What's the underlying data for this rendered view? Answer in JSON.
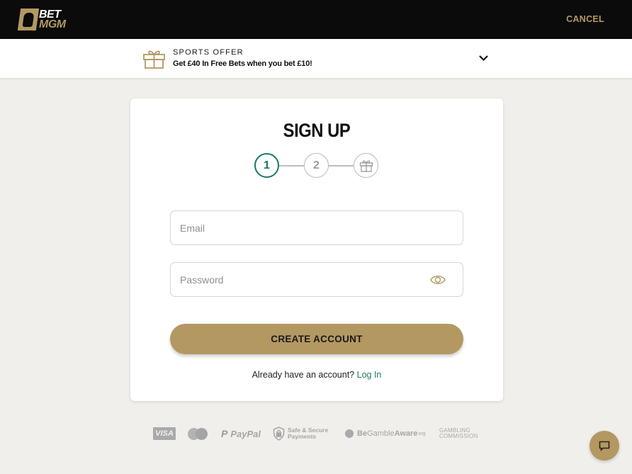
{
  "header": {
    "logo": {
      "line1": "BET",
      "line2": "MGM"
    },
    "cancel_label": "CANCEL"
  },
  "offer": {
    "kicker": "SPORTS OFFER",
    "text": "Get £40 In Free Bets when you bet £10!",
    "icon": "gift-icon",
    "toggle_icon": "chevron-down-icon"
  },
  "signup": {
    "title": "SIGN UP",
    "steps": [
      {
        "label": "1",
        "state": "active"
      },
      {
        "label": "2",
        "state": "inactive"
      },
      {
        "label": "",
        "icon": "gift-icon",
        "state": "inactive"
      }
    ],
    "email": {
      "placeholder": "Email",
      "value": ""
    },
    "password": {
      "placeholder": "Password",
      "value": "",
      "toggle_icon": "eye-icon"
    },
    "create_button": "CREATE ACCOUNT",
    "login_prompt": "Already have an account?",
    "login_link": "Log In"
  },
  "footer": {
    "visa": "VISA",
    "paypal": "PayPal",
    "paypal_mark": "P",
    "secure_line1": "Safe & Secure",
    "secure_line2": "Payments",
    "begamble_be": "Be",
    "begamble_gamble": "Gamble",
    "begamble_aware": "Aware",
    "begamble_org": "org",
    "commission_line1": "GAMBLING",
    "commission_line2": "COMMISSION"
  },
  "colors": {
    "brand_gold": "#b39862",
    "accent_green": "#1a7a63",
    "header_bg": "#0b0b0b",
    "page_bg": "#f0efeb"
  }
}
